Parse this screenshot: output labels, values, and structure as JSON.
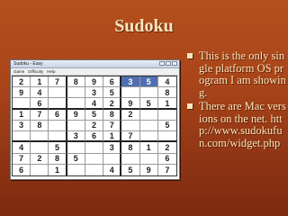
{
  "slide": {
    "title": "Sudoku"
  },
  "window": {
    "title": "Sudoku - Easy",
    "menu": [
      "Game",
      "Difficulty",
      "Help"
    ]
  },
  "sudoku": {
    "highlight_color": "#4f6fb0",
    "highlighted": [
      [
        0,
        6
      ],
      [
        0,
        7
      ]
    ],
    "rows": [
      [
        "2",
        "1",
        "7",
        "8",
        "9",
        "6",
        "3",
        "5",
        "4"
      ],
      [
        "9",
        "4",
        "",
        "",
        "3",
        "5",
        "",
        "",
        "8"
      ],
      [
        "",
        "6",
        "",
        "",
        "4",
        "2",
        "9",
        "5",
        "1"
      ],
      [
        "1",
        "7",
        "6",
        "9",
        "5",
        "8",
        "2",
        "",
        ""
      ],
      [
        "3",
        "8",
        "",
        "",
        "2",
        "7",
        "",
        "",
        "5"
      ],
      [
        "",
        "",
        "",
        "3",
        "6",
        "1",
        "7",
        "",
        ""
      ],
      [
        "4",
        "",
        "5",
        "",
        "",
        "3",
        "8",
        "1",
        "2"
      ],
      [
        "7",
        "2",
        "8",
        "5",
        "",
        "",
        "",
        "",
        "6"
      ],
      [
        "6",
        "",
        "1",
        "",
        "",
        "4",
        "5",
        "9",
        "7"
      ]
    ]
  },
  "bullets": [
    {
      "text": "This is the only single platform OS program I am showing."
    },
    {
      "text": "There are Mac versions on the net. http://www.sudokufun.com/widget.php"
    }
  ]
}
